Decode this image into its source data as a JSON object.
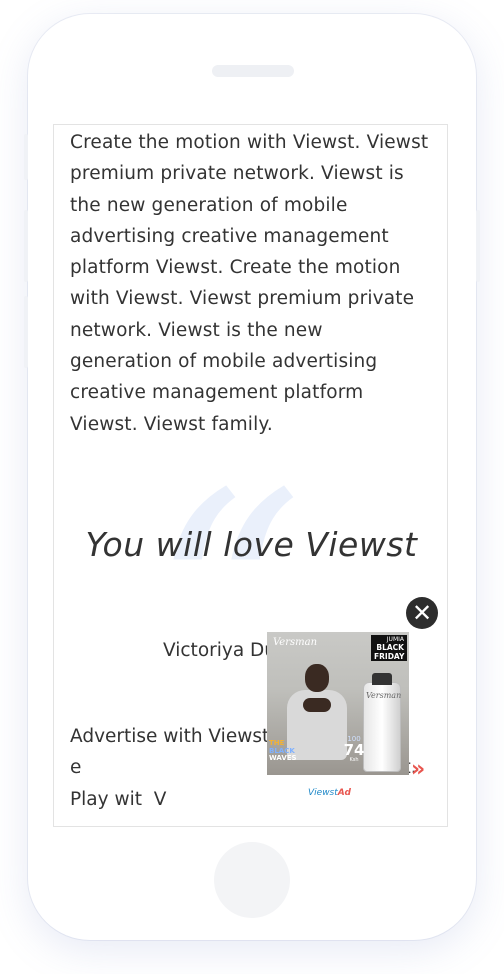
{
  "article": {
    "paragraph": "Create the motion with Viewst. Viewst premium private network. Viewst is the new generation of mobile advertising creative management platform Viewst. Create the motion with Viewst. Viewst premium private network. Viewst is the new generation of mobile advertising creative management platform Viewst. Viewst family.",
    "quote": "You will love Viewst",
    "author": "Victoriya Dul",
    "bottom_paragraph": "Advertise with Viewst e                                 nd with Viewst. Play wit  V"
  },
  "ad": {
    "close_icon": "close-icon",
    "brand": "Versman",
    "badge_top": "JUMIA",
    "badge_main": "BLACK FRIDAY",
    "promo_line1": "THE",
    "promo_line2": "BLACK",
    "promo_line3": "WAVES",
    "old_price": "100",
    "price": "74",
    "currency": "Ksh",
    "bottle_label": "Versman",
    "next_label": "»",
    "footer_brand": "Viewst",
    "footer_ad": "Ad"
  },
  "colors": {
    "accent_red": "#e8554e",
    "footer_blue": "#1e88c8",
    "quote_mark": "#eaf0fb"
  }
}
